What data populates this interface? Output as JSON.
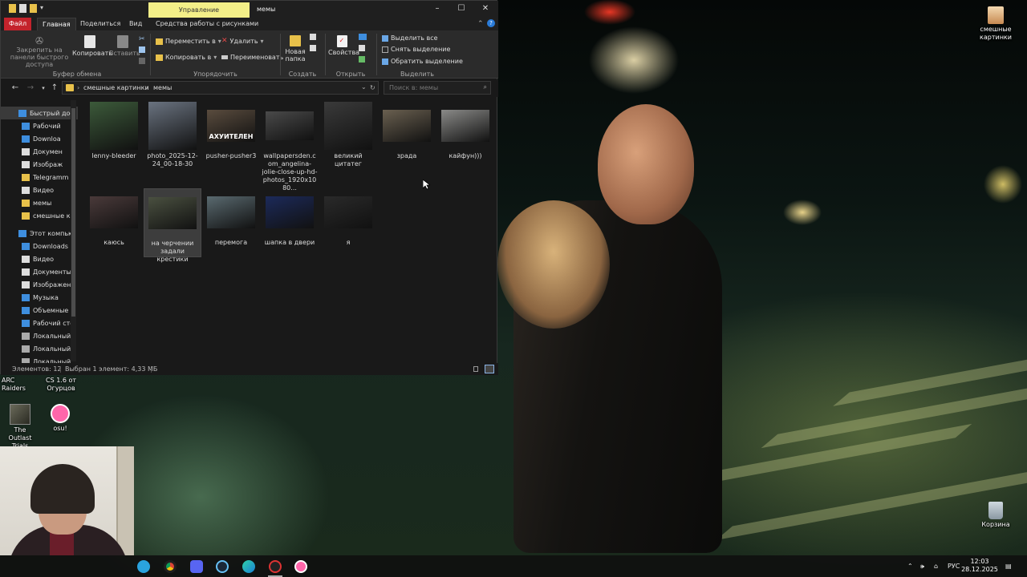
{
  "window": {
    "title": "мемы",
    "context_tab": "Управление",
    "tabs": [
      "Файл",
      "Главная",
      "Поделиться",
      "Вид",
      "Средства работы с рисунками"
    ]
  },
  "ribbon": {
    "pin_label": "Закрепить на панели быстрого доступа",
    "copy_label": "Копировать",
    "paste_label": "Вставить",
    "group_clipboard": "Буфер обмена",
    "move_to": "Переместить в",
    "copy_to": "Копировать в",
    "delete_label": "Удалить",
    "rename_label": "Переименовать",
    "group_organize": "Упорядочить",
    "new_folder": "Новая папка",
    "group_create": "Создать",
    "properties": "Свойства",
    "group_open": "Открыть",
    "select_all": "Выделить все",
    "select_none": "Снять выделение",
    "invert_selection": "Обратить выделение",
    "group_select": "Выделить"
  },
  "address": {
    "crumbs": [
      "смешные картинки",
      "мемы"
    ],
    "search_placeholder": "Поиск в: мемы"
  },
  "nav_items": [
    {
      "label": "Быстрый дос",
      "selected": true
    },
    {
      "label": "Рабочий"
    },
    {
      "label": "Downloa"
    },
    {
      "label": "Докумен"
    },
    {
      "label": "Изображ"
    },
    {
      "label": "Telegramm"
    },
    {
      "label": "Видео"
    },
    {
      "label": "мемы"
    },
    {
      "label": "смешные к"
    },
    {
      "label": "Этот компью"
    },
    {
      "label": "Downloads"
    },
    {
      "label": "Видео"
    },
    {
      "label": "Документы"
    },
    {
      "label": "Изображен"
    },
    {
      "label": "Музыка"
    },
    {
      "label": "Объемные"
    },
    {
      "label": "Рабочий сто"
    },
    {
      "label": "Локальный"
    },
    {
      "label": "Локальный"
    },
    {
      "label": "Локальный"
    }
  ],
  "files": [
    {
      "name": "lenny-bleeder",
      "color": "#3c5a3a"
    },
    {
      "name": "photo_2025-12-24_00-18-30",
      "color": "#6a7380"
    },
    {
      "name": "pusher-pusher3",
      "color": "#5a4c3e",
      "caption": "АХУИТЕЛЕН"
    },
    {
      "name": "wallpapersden.com_angelina-jolie-close-up-hd-photos_1920x1080...",
      "color": "#4a4a4a"
    },
    {
      "name": "великий цитатег",
      "color": "#3a3a3a"
    },
    {
      "name": "зрада",
      "color": "#6a6050"
    },
    {
      "name": "кайфун)))",
      "color": "#8a8a88"
    },
    {
      "name": "каюсь",
      "color": "#4a3a3a"
    },
    {
      "name": "на черчении задали крестики",
      "color": "#4a5040",
      "selected": true
    },
    {
      "name": "перемога",
      "color": "#5a6a70"
    },
    {
      "name": "шапка в двери",
      "color": "#1c2a5a"
    },
    {
      "name": "я",
      "color": "#2a2a2a"
    }
  ],
  "status": {
    "count": "Элементов: 12",
    "selected": "Выбран 1 элемент: 4,33 МБ"
  },
  "desktop_icons": [
    {
      "label": "смешные картинки"
    },
    {
      "label": "ARC Raiders"
    },
    {
      "label": "CS 1.6 от Огурцов"
    },
    {
      "label": "The Outlast Trials"
    },
    {
      "label": "osu!"
    },
    {
      "label": "Корзина"
    }
  ],
  "tray": {
    "lang": "РУС",
    "time": "12:03",
    "date": "28.12.2025"
  }
}
